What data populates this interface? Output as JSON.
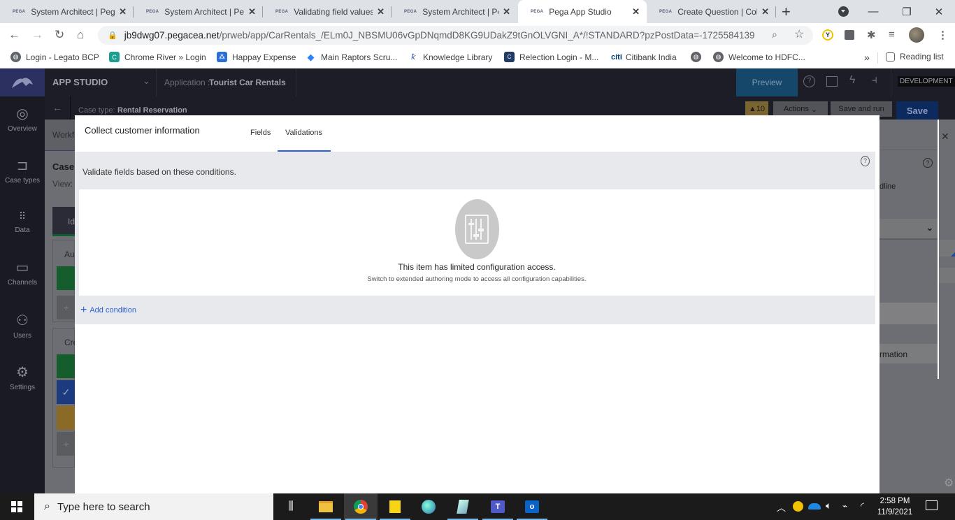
{
  "browser": {
    "tabs": [
      {
        "favicon": "PEGA",
        "title": "System Architect | Peg",
        "active": false
      },
      {
        "favicon": "PEGA",
        "title": "System Architect | Peg",
        "active": false
      },
      {
        "favicon": "PEGA",
        "title": "Validating field values",
        "active": false
      },
      {
        "favicon": "PEGA",
        "title": "System Architect | Peg",
        "active": false
      },
      {
        "favicon": "PEGA",
        "title": "Pega App Studio",
        "active": true
      },
      {
        "favicon": "PEGA",
        "title": "Create Question | Coll",
        "active": false
      }
    ],
    "new_tab": "+",
    "window_controls": {
      "minimize": "—",
      "restore": "❐",
      "close": "✕"
    },
    "url_host": "jb9dwg07.pegacea.net",
    "url_path": "/prweb/app/CarRentals_/ELm0J_NBSMU06vGpDNqmdD8KG9UDakZ9tGnOLVGNI_A*/!STANDARD?pzPostData=-1725584139",
    "bookmarks": [
      {
        "label": "Login - Legato BCP",
        "icon": "globe-icon",
        "color": "#5f6368"
      },
      {
        "label": "Chrome River » Login",
        "icon": "chrome-river-icon",
        "color": "#1a9e8f"
      },
      {
        "label": "Happay Expense",
        "icon": "happay-icon",
        "color": "#2b6fd6"
      },
      {
        "label": "Main Raptors Scru...",
        "icon": "jira-icon",
        "color": "#2684ff"
      },
      {
        "label": "Knowledge Library",
        "icon": "knowledge-icon",
        "color": "#3a5ba0"
      },
      {
        "label": "Relection Login - M...",
        "icon": "relection-icon",
        "color": "#1f3b66"
      },
      {
        "label": "Citibank India",
        "icon": "citi-icon",
        "color": "#003b70"
      },
      {
        "label": "",
        "icon": "globe-icon",
        "color": "#5f6368"
      },
      {
        "label": "Welcome to HDFC...",
        "icon": "globe-icon",
        "color": "#5f6368"
      }
    ],
    "more_bookmarks": "»",
    "reading_list": "Reading list"
  },
  "app": {
    "studio_label": "APP STUDIO",
    "application_label": "Application :",
    "application_name": "Tourist Car Rentals",
    "preview_label": "Preview",
    "environment_badge": "DEVELOPMENT",
    "case_type_label": "Case type:",
    "case_type_name": "Rental Reservation",
    "warning_count": "10",
    "actions_label": "Actions",
    "save_and_run_label": "Save and run",
    "save_label": "Save",
    "sidebar": [
      {
        "label": "Overview",
        "icon": "gauge-icon"
      },
      {
        "label": "Case types",
        "icon": "case-type-icon"
      },
      {
        "label": "Data",
        "icon": "data-grid-icon"
      },
      {
        "label": "Channels",
        "icon": "channels-icon"
      },
      {
        "label": "Users",
        "icon": "users-icon"
      },
      {
        "label": "Settings",
        "icon": "settings-icon"
      }
    ],
    "background": {
      "workflow_tab": "Workfl",
      "case_heading": "Case",
      "view_label": "View:",
      "stage_label": "Id",
      "process1_label": "Au",
      "process2_label": "Cre",
      "right_partial1": "dline",
      "right_partial2": "rmation"
    }
  },
  "modal": {
    "title": "Collect customer information",
    "tabs": [
      {
        "label": "Fields",
        "active": false
      },
      {
        "label": "Validations",
        "active": true
      }
    ],
    "description": "Validate fields based on these conditions.",
    "empty_title": "This item has limited configuration access.",
    "empty_subtitle": "Switch to extended authoring mode to access all configuration capabilities.",
    "add_condition": "Add condition"
  },
  "taskbar": {
    "search_placeholder": "Type here to search",
    "time": "2:58 PM",
    "date": "11/9/2021"
  }
}
